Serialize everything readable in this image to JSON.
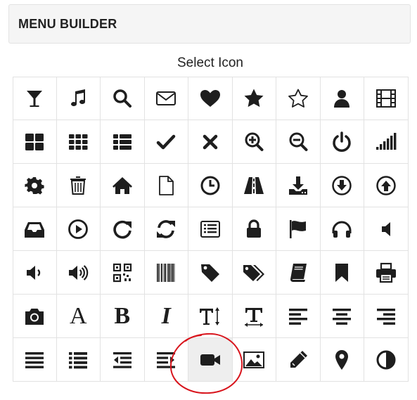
{
  "header": {
    "title": "MENU BUILDER"
  },
  "picker": {
    "title": "Select Icon"
  },
  "icons": [
    "glass-icon",
    "music-icon",
    "search-icon",
    "envelope-icon",
    "heart-icon",
    "star-icon",
    "star-outline-icon",
    "user-icon",
    "film-icon",
    "th-large-icon",
    "th-icon",
    "th-list-icon",
    "check-icon",
    "remove-icon",
    "zoom-in-icon",
    "zoom-out-icon",
    "power-icon",
    "signal-icon",
    "cog-icon",
    "trash-icon",
    "home-icon",
    "file-icon",
    "clock-icon",
    "road-icon",
    "download-alt-icon",
    "download-icon",
    "upload-icon",
    "inbox-icon",
    "play-circle-icon",
    "repeat-icon",
    "refresh-icon",
    "list-alt-icon",
    "lock-icon",
    "flag-icon",
    "headphones-icon",
    "volume-off-icon",
    "volume-down-icon",
    "volume-up-icon",
    "qrcode-icon",
    "barcode-icon",
    "tag-icon",
    "tags-icon",
    "book-icon",
    "bookmark-icon",
    "print-icon",
    "camera-icon",
    "font-icon",
    "bold-icon",
    "italic-icon",
    "text-height-icon",
    "text-width-icon",
    "align-left-icon",
    "align-center-icon",
    "align-right-icon",
    "align-justify-icon",
    "list-icon",
    "indent-left-icon",
    "indent-right-icon",
    "facetime-video-icon",
    "picture-icon",
    "pencil-icon",
    "map-marker-icon",
    "adjust-icon"
  ],
  "selected_icon": "facetime-video-icon",
  "glyph_labels": {
    "font-icon": "A",
    "bold-icon": "B",
    "italic-icon": "I",
    "text-height-icon": "T",
    "text-width-icon": "T"
  },
  "colors": {
    "icon": "#1e1e1e",
    "selected_bg": "#eeeeee",
    "annotation": "#d8141c",
    "grid_line": "#e2e2e2"
  }
}
